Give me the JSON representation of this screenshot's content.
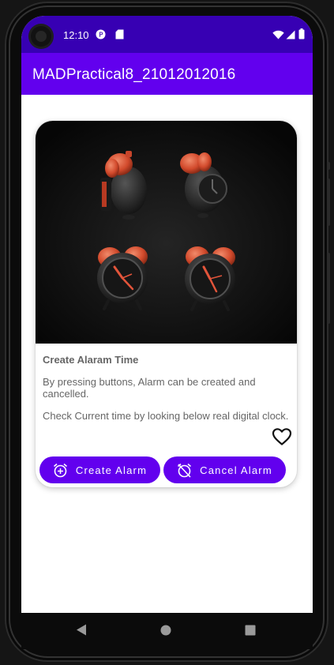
{
  "status_bar": {
    "time": "12:10",
    "icons": [
      "notification-p-icon",
      "sd-card-icon",
      "wifi-icon",
      "signal-icon",
      "battery-icon"
    ]
  },
  "app_bar": {
    "title": "MADPractical8_21012012016"
  },
  "card": {
    "image": "alarm-clocks-image",
    "title": "Create Alaram Time",
    "description": "By pressing buttons, Alarm can be created and cancelled.",
    "description2": "Check Current time by looking below real digital clock.",
    "favorite_icon": "heart-outline-icon"
  },
  "buttons": {
    "create_label": "Create Alarm",
    "create_icon": "alarm-add-icon",
    "cancel_label": "Cancel Alarm",
    "cancel_icon": "alarm-off-icon"
  },
  "nav_bar": {
    "icons": [
      "back-icon",
      "home-icon",
      "recents-icon"
    ]
  },
  "colors": {
    "status_bar": "#3700b3",
    "primary": "#6200ee",
    "text_secondary": "#666666"
  }
}
